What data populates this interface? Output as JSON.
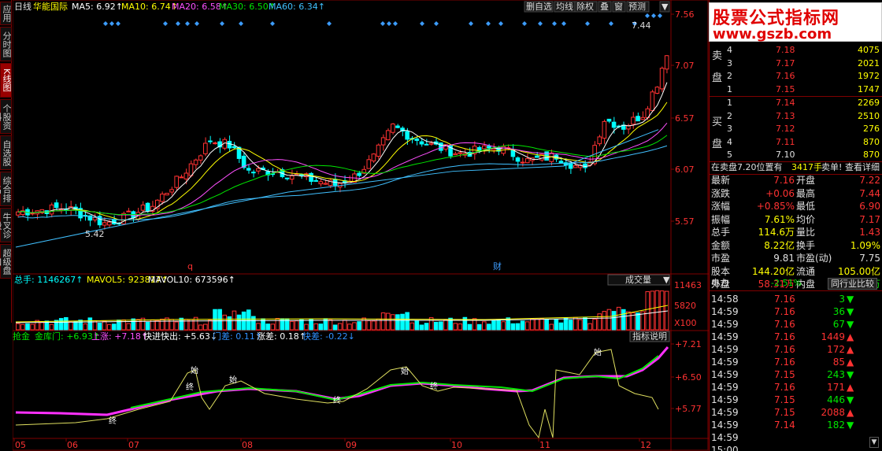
{
  "left_tabs": [
    "应用",
    "分时图",
    "K线图",
    "个股资料",
    "自选股",
    "综合排名",
    "牛叉诊股",
    "超级盘口"
  ],
  "header": {
    "period": "日线",
    "stock_name": "华能国际",
    "ma": [
      {
        "label": "MA5: 6.92↑",
        "color": "#ffffff"
      },
      {
        "label": "MA10: 6.74↑",
        "color": "#ffff00"
      },
      {
        "label": "MA20: 6.58↑",
        "color": "#ff50ff"
      },
      {
        "label": "MA30: 6.50↑",
        "color": "#00e600"
      },
      {
        "label": "MA60: 6.34↑",
        "color": "#40c0ff"
      }
    ],
    "toolbar": [
      "删自选",
      "均线",
      "除权",
      "叠",
      "窗",
      "预测"
    ],
    "toolbar_arrow": "▼"
  },
  "price_axis": [
    "7.56",
    "7.07",
    "6.57",
    "6.07",
    "5.57"
  ],
  "price_annotations": {
    "high": "7.44",
    "low": "5.42",
    "marker_q": "q",
    "marker_cai": "财"
  },
  "volume": {
    "header": [
      {
        "label": "总手: 1146267↑",
        "color": "#00ffff"
      },
      {
        "label": "MAVOL5: 923817↑",
        "color": "#ffff00"
      },
      {
        "label": "MAVOL10: 673596↑",
        "color": "#ffffff"
      }
    ],
    "selector": "成交量",
    "selector_arrow": "▼",
    "axis": [
      "11463",
      "5820",
      "X100"
    ]
  },
  "indicator": {
    "header": [
      {
        "label": "抢金",
        "color": "#00e600"
      },
      {
        "label": "金库门: +6.93↑",
        "color": "#00e600"
      },
      {
        "label": "上涨: +7.18↑",
        "color": "#ff50ff"
      },
      {
        "label": "快进快出: +5.63↓",
        "color": "#ffffff"
      },
      {
        "label": "门差: 0.11↑",
        "color": "#3090ff"
      },
      {
        "label": "涨差: 0.18↑",
        "color": "#ffffff"
      },
      {
        "label": "快差: -0.22↓",
        "color": "#3090ff"
      }
    ],
    "button": "指标说明",
    "axis": [
      "+7.21",
      "+6.50",
      "+5.77"
    ],
    "labels": [
      "始",
      "始",
      "始",
      "始",
      "终",
      "终",
      "终",
      "终"
    ]
  },
  "date_axis": [
    "05",
    "06",
    "07",
    "08",
    "09",
    "10",
    "11",
    "12"
  ],
  "watermark": {
    "line1": "股票公式指标网",
    "line2": "www.gszb.com"
  },
  "order_book": {
    "sell_label": [
      "卖",
      "盘"
    ],
    "buy_label": [
      "买",
      "盘"
    ],
    "sell": [
      {
        "level": "4",
        "price": "7.18",
        "vol": "4075"
      },
      {
        "level": "3",
        "price": "7.17",
        "vol": "2021"
      },
      {
        "level": "2",
        "price": "7.16",
        "vol": "1972"
      },
      {
        "level": "1",
        "price": "7.15",
        "vol": "1747"
      }
    ],
    "buy": [
      {
        "level": "1",
        "price": "7.14",
        "vol": "2269"
      },
      {
        "level": "2",
        "price": "7.13",
        "vol": "2510"
      },
      {
        "level": "3",
        "price": "7.12",
        "vol": "276"
      },
      {
        "level": "4",
        "price": "7.11",
        "vol": "870"
      },
      {
        "level": "5",
        "price": "7.10",
        "vol": "870"
      }
    ],
    "pending": {
      "left": "在卖盘7.20位置有",
      "mid": "3417手",
      "right1": "卖单!",
      "right2": "查看详细"
    }
  },
  "quote": [
    {
      "k1": "最新",
      "v1": "7.16",
      "c1": "#ff3232",
      "k2": "开盘",
      "v2": "7.22",
      "c2": "#ff3232"
    },
    {
      "k1": "涨跌",
      "v1": "+0.06",
      "c1": "#ff3232",
      "k2": "最高",
      "v2": "7.44",
      "c2": "#ff3232"
    },
    {
      "k1": "涨幅",
      "v1": "+0.85%",
      "c1": "#ff3232",
      "k2": "最低",
      "v2": "6.90",
      "c2": "#ff3232"
    },
    {
      "k1": "振幅",
      "v1": "7.61%",
      "c1": "#ffff00",
      "k2": "均价",
      "v2": "7.17",
      "c2": "#ff3232"
    },
    {
      "k1": "总手",
      "v1": "114.6万",
      "c1": "#ffff00",
      "k2": "量比",
      "v2": "1.43",
      "c2": "#ff3232"
    },
    {
      "k1": "金额",
      "v1": "8.22亿",
      "c1": "#ffff00",
      "k2": "换手",
      "v2": "1.09%",
      "c2": "#ffff00"
    },
    {
      "k1": "市盈",
      "v1": "9.81",
      "c1": "#e0e0e0",
      "k2": "市盈(动)",
      "v2": "7.75",
      "c2": "#e0e0e0"
    },
    {
      "k1": "股本",
      "v1": "144.20亿",
      "c1": "#ffff00",
      "k2": "流通",
      "v2": "105.00亿",
      "c2": "#ffff00"
    },
    {
      "k1": "外盘",
      "v1": "58.31万",
      "c1": "#ff3232",
      "k2": "内盘",
      "v2": "56.31万",
      "c2": "#00e600"
    }
  ],
  "sector": {
    "name": "电力",
    "change": "-2.51%",
    "button": "同行业比较"
  },
  "ticks": [
    {
      "time": "14:58",
      "price": "7.16",
      "vol": "3",
      "dir": "down"
    },
    {
      "time": "14:59",
      "price": "7.16",
      "vol": "36",
      "dir": "down"
    },
    {
      "time": "14:59",
      "price": "7.16",
      "vol": "67",
      "dir": "down"
    },
    {
      "time": "14:59",
      "price": "7.16",
      "vol": "1449",
      "dir": "up"
    },
    {
      "time": "14:59",
      "price": "7.16",
      "vol": "172",
      "dir": "up"
    },
    {
      "time": "14:59",
      "price": "7.16",
      "vol": "85",
      "dir": "up"
    },
    {
      "time": "14:59",
      "price": "7.15",
      "vol": "243",
      "dir": "down"
    },
    {
      "time": "14:59",
      "price": "7.16",
      "vol": "171",
      "dir": "up"
    },
    {
      "time": "14:59",
      "price": "7.15",
      "vol": "446",
      "dir": "down"
    },
    {
      "time": "14:59",
      "price": "7.15",
      "vol": "2088",
      "dir": "up"
    },
    {
      "time": "14:59",
      "price": "7.14",
      "vol": "182",
      "dir": "down"
    },
    {
      "time": "14:59",
      "price": "",
      "vol": "",
      "dir": ""
    },
    {
      "time": "15:00",
      "price": "",
      "vol": "",
      "dir": ""
    }
  ],
  "colors": {
    "up": "#ff3232",
    "down": "#00ffff",
    "border": "#800000"
  }
}
